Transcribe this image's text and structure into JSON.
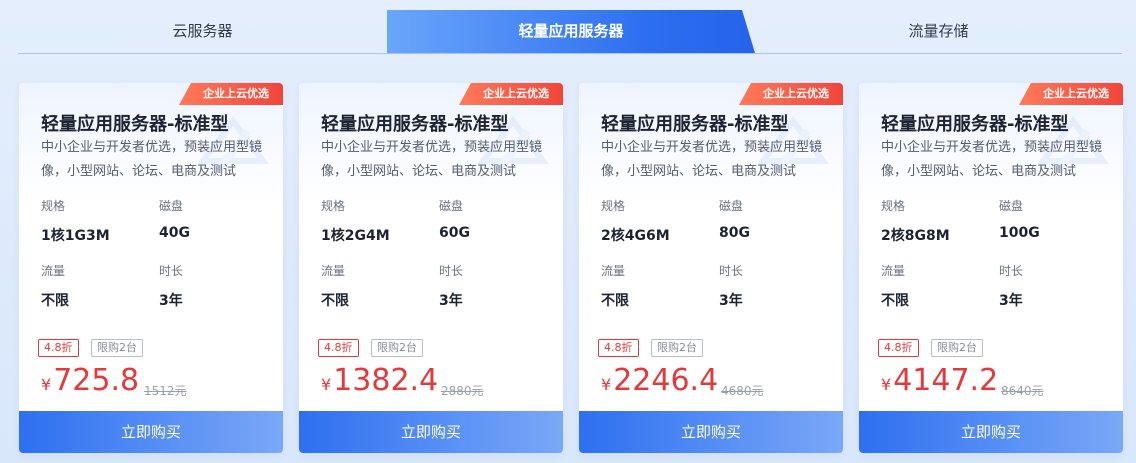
{
  "tabs": [
    {
      "label": "云服务器"
    },
    {
      "label": "轻量应用服务器"
    },
    {
      "label": "流量存储"
    }
  ],
  "active_tab": 1,
  "colors": {
    "accent": "#2d6ff0",
    "price": "#e4393c",
    "badge": "#f0453a"
  },
  "cards": [
    {
      "badge": "企业上云优选",
      "title": "轻量应用服务器-标准型",
      "description": "中小企业与开发者优选，预装应用型镜像，小型网站、论坛、电商及测试",
      "spec_label": "规格",
      "spec_value": "1核1G3M",
      "disk_label": "磁盘",
      "disk_value": "40G",
      "traffic_label": "流量",
      "traffic_value": "不限",
      "duration_label": "时长",
      "duration_value": "3年",
      "discount": "4.8折",
      "limit": "限购2台",
      "currency": "¥",
      "price": "725.8",
      "original_price": "1512元",
      "buy_label": "立即购买"
    },
    {
      "badge": "企业上云优选",
      "title": "轻量应用服务器-标准型",
      "description": "中小企业与开发者优选，预装应用型镜像，小型网站、论坛、电商及测试",
      "spec_label": "规格",
      "spec_value": "1核2G4M",
      "disk_label": "磁盘",
      "disk_value": "60G",
      "traffic_label": "流量",
      "traffic_value": "不限",
      "duration_label": "时长",
      "duration_value": "3年",
      "discount": "4.8折",
      "limit": "限购2台",
      "currency": "¥",
      "price": "1382.4",
      "original_price": "2880元",
      "buy_label": "立即购买"
    },
    {
      "badge": "企业上云优选",
      "title": "轻量应用服务器-标准型",
      "description": "中小企业与开发者优选，预装应用型镜像，小型网站、论坛、电商及测试",
      "spec_label": "规格",
      "spec_value": "2核4G6M",
      "disk_label": "磁盘",
      "disk_value": "80G",
      "traffic_label": "流量",
      "traffic_value": "不限",
      "duration_label": "时长",
      "duration_value": "3年",
      "discount": "4.8折",
      "limit": "限购2台",
      "currency": "¥",
      "price": "2246.4",
      "original_price": "4680元",
      "buy_label": "立即购买"
    },
    {
      "badge": "企业上云优选",
      "title": "轻量应用服务器-标准型",
      "description": "中小企业与开发者优选，预装应用型镜像，小型网站、论坛、电商及测试",
      "spec_label": "规格",
      "spec_value": "2核8G8M",
      "disk_label": "磁盘",
      "disk_value": "100G",
      "traffic_label": "流量",
      "traffic_value": "不限",
      "duration_label": "时长",
      "duration_value": "3年",
      "discount": "4.8折",
      "limit": "限购2台",
      "currency": "¥",
      "price": "4147.2",
      "original_price": "8640元",
      "buy_label": "立即购买"
    }
  ]
}
